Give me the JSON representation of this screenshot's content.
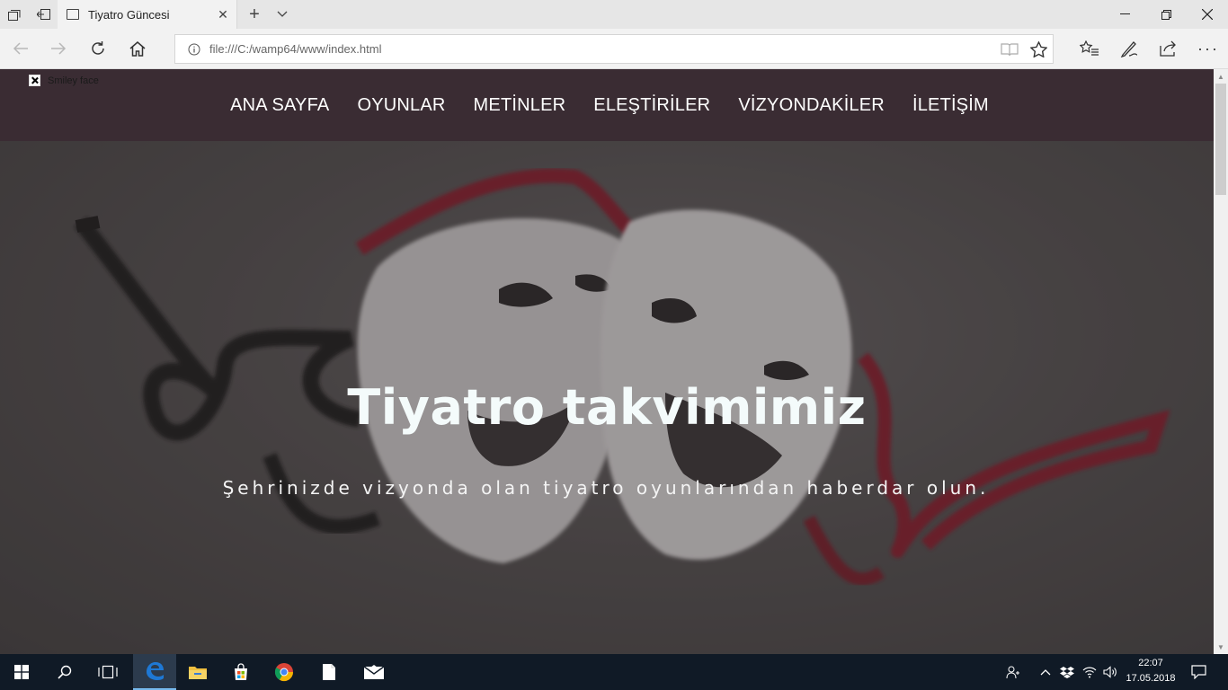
{
  "browser": {
    "tab_title": "Tiyatro Güncesi",
    "address": "file:///C:/wamp64/www/index.html"
  },
  "page": {
    "broken_image_alt": "Smiley face",
    "menu": [
      {
        "label": "ANA SAYFA"
      },
      {
        "label": "OYUNLAR"
      },
      {
        "label": "METİNLER"
      },
      {
        "label": "ELEŞTİRİLER"
      },
      {
        "label": "VİZYONDAKİLER"
      },
      {
        "label": "İLETİŞİM"
      }
    ],
    "hero_title": "Tiyatro takvimimiz",
    "hero_subtitle": "Şehrinizde vizyonda olan tiyatro oyunlarından haberdar olun."
  },
  "taskbar": {
    "time": "22:07",
    "date": "17.05.2018"
  },
  "colors": {
    "header_bg": "#3a2c33",
    "hero_title": "#f4fbfb",
    "taskbar_bg": "#101a26",
    "edge_blue": "#1e78d4"
  }
}
